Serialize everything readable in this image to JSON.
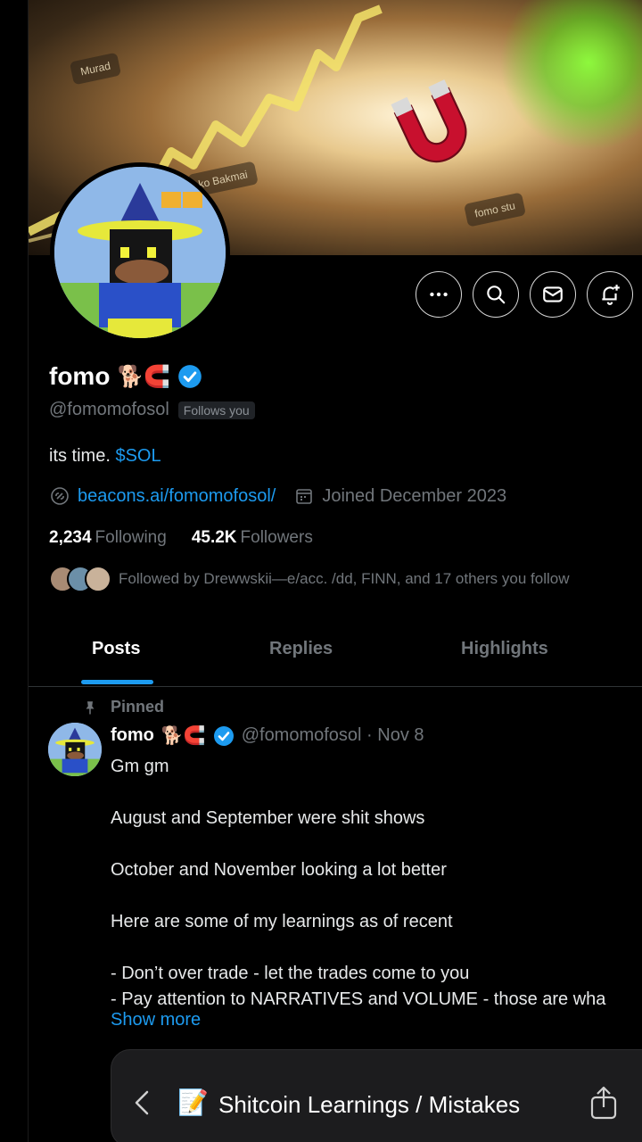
{
  "banner": {
    "card_labels": [
      "Murad",
      "ko Bakmai",
      "fomo stu"
    ]
  },
  "actions": {
    "more": "more-options",
    "search": "search",
    "message": "message",
    "notify": "notifications"
  },
  "profile": {
    "name": "fomo",
    "name_emoji": "🐕🧲",
    "handle": "@fomomofosol",
    "follows_you": "Follows you",
    "bio_text": "its time. ",
    "bio_cashtag": "$SOL",
    "link": "beacons.ai/fomomofosol/",
    "joined": "Joined December 2023",
    "following_count": "2,234",
    "following_label": "Following",
    "followers_count": "45.2K",
    "followers_label": "Followers",
    "followed_by": "Followed by Drewwskii—e/acc. /dd, FINN, and 17 others you follow"
  },
  "tabs": [
    {
      "label": "Posts",
      "active": true
    },
    {
      "label": "Replies",
      "active": false
    },
    {
      "label": "Highlights",
      "active": false
    }
  ],
  "post": {
    "pinned_label": "Pinned",
    "name": "fomo",
    "name_emoji": "🐕🧲",
    "meta": "@fomomofosol · Nov 8",
    "body": "Gm gm\n\nAugust and September were shit shows\n\nOctober and November looking a lot better\n\nHere are some of my learnings as of recent\n\n- Don’t over trade - let the trades come to you\n- Pay attention to NARRATIVES and VOLUME - those are wha",
    "show_more": "Show more"
  },
  "card": {
    "emoji": "📝",
    "title": "Shitcoin Learnings / Mistakes"
  },
  "colors": {
    "accent": "#1d9bf0",
    "muted": "#71767b",
    "background": "#000000"
  }
}
